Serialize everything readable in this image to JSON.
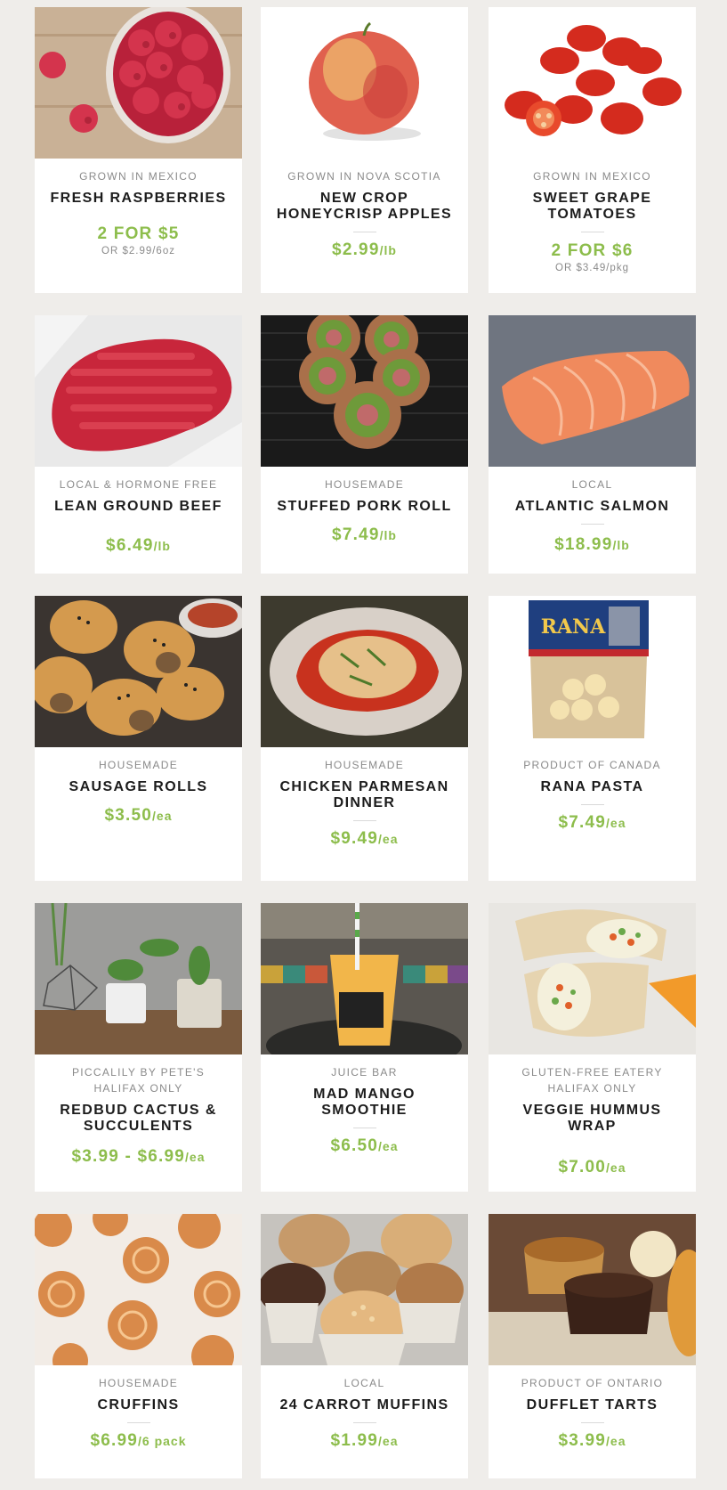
{
  "colors": {
    "page_bg": "#efedea",
    "card_bg": "#ffffff",
    "price": "#8dbd4c",
    "origin": "#8a8a8a",
    "name": "#1c1c1c"
  },
  "products": [
    {
      "origin": "GROWN IN MEXICO",
      "name": "FRESH RASPBERRIES",
      "deal": "2 FOR $5",
      "alt": "OR $2.99/6oz",
      "image": "raspberries-photo"
    },
    {
      "origin": "GROWN IN NOVA SCOTIA",
      "name": "NEW CROP HONEYCRISP APPLES",
      "price": "$2.99",
      "unit": "/lb",
      "image": "apple-photo"
    },
    {
      "origin": "GROWN IN MEXICO",
      "name": "SWEET GRAPE TOMATOES",
      "deal": "2 FOR $6",
      "alt": "OR $3.49/pkg",
      "image": "tomatoes-photo"
    },
    {
      "origin": "LOCAL & HORMONE FREE",
      "name": "LEAN GROUND BEEF",
      "price": "$6.49",
      "unit": "/lb",
      "image": "ground-beef-photo"
    },
    {
      "origin": "HOUSEMADE",
      "name": "STUFFED PORK ROLL",
      "price": "$7.49",
      "unit": "/lb",
      "image": "pork-roll-photo"
    },
    {
      "origin": "LOCAL",
      "name": "ATLANTIC SALMON",
      "price": "$18.99",
      "unit": "/lb",
      "image": "salmon-photo"
    },
    {
      "origin": "HOUSEMADE",
      "name": "SAUSAGE ROLLS",
      "price": "$3.50",
      "unit": "/ea",
      "image": "sausage-rolls-photo"
    },
    {
      "origin": "HOUSEMADE",
      "name": "CHICKEN PARMESAN DINNER",
      "price": "$9.49",
      "unit": "/ea",
      "image": "chicken-parmesan-photo"
    },
    {
      "origin": "PRODUCT OF CANADA",
      "name": "RANA PASTA",
      "price": "$7.49",
      "unit": "/ea",
      "image": "rana-pasta-photo",
      "brand": "RANA"
    },
    {
      "origin": "PICCALILY BY PETE'S",
      "origin2": "HALIFAX ONLY",
      "name": "REDBUD CACTUS & SUCCULENTS",
      "price": "$3.99 - $6.99",
      "unit": "/ea",
      "image": "succulents-photo"
    },
    {
      "origin": "JUICE BAR",
      "name": "MAD MANGO SMOOTHIE",
      "price": "$6.50",
      "unit": "/ea",
      "image": "smoothie-photo"
    },
    {
      "origin": "GLUTEN-FREE EATERY",
      "origin2": "HALIFAX ONLY",
      "name": "VEGGIE HUMMUS WRAP",
      "price": "$7.00",
      "unit": "/ea",
      "image": "hummus-wrap-photo"
    },
    {
      "origin": "HOUSEMADE",
      "name": "CRUFFINS",
      "price": "$6.99",
      "unit": "/6 pack",
      "image": "cruffins-photo"
    },
    {
      "origin": "LOCAL",
      "name": "24 CARROT MUFFINS",
      "price": "$1.99",
      "unit": "/ea",
      "image": "carrot-muffins-photo"
    },
    {
      "origin": "PRODUCT OF ONTARIO",
      "name": "DUFFLET TARTS",
      "price": "$3.99",
      "unit": "/ea",
      "image": "tarts-photo"
    }
  ]
}
